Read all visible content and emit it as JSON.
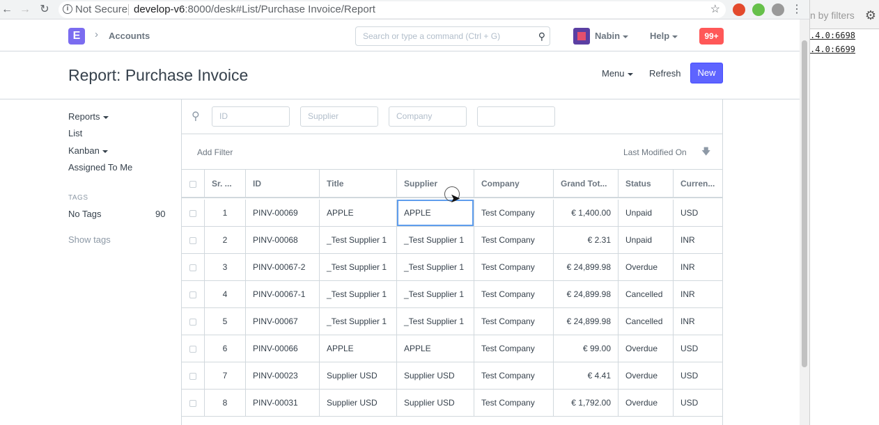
{
  "browser": {
    "not_secure": "Not Secure",
    "url_host": "develop-v6",
    "url_rest": ":8000/desk#List/Purchase Invoice/Report"
  },
  "devtools": {
    "filter_text": "n by filters",
    "line1": ".4.0:6698",
    "line2": ".4.0:6699"
  },
  "navbar": {
    "logo": "E",
    "breadcrumb": "Accounts",
    "search_placeholder": "Search or type a command (Ctrl + G)",
    "user": "Nabin",
    "help": "Help",
    "notifications": "99+"
  },
  "page": {
    "title": "Report: Purchase Invoice",
    "menu": "Menu",
    "refresh": "Refresh",
    "new": "New"
  },
  "sidebar": {
    "reports": "Reports",
    "list": "List",
    "kanban": "Kanban",
    "assigned": "Assigned To Me",
    "tags_heading": "TAGS",
    "no_tags": "No Tags",
    "no_tags_count": "90",
    "show_tags": "Show tags"
  },
  "filters": {
    "id_placeholder": "ID",
    "supplier_placeholder": "Supplier",
    "company_placeholder": "Company",
    "fourth_placeholder": "",
    "add_filter": "Add Filter",
    "sort_by": "Last Modified On"
  },
  "grid": {
    "columns": [
      "Sr. ...",
      "ID",
      "Title",
      "Supplier",
      "Company",
      "Grand Tot...",
      "Status",
      "Curren..."
    ],
    "rows": [
      {
        "sr": "1",
        "id": "PINV-00069",
        "title": "APPLE",
        "supplier": "APPLE",
        "company": "Test Company",
        "total": "€ 1,400.00",
        "status": "Unpaid",
        "currency": "USD"
      },
      {
        "sr": "2",
        "id": "PINV-00068",
        "title": "_Test Supplier 1",
        "supplier": "_Test Supplier 1",
        "company": "Test Company",
        "total": "€ 2.31",
        "status": "Unpaid",
        "currency": "INR"
      },
      {
        "sr": "3",
        "id": "PINV-00067-2",
        "title": "_Test Supplier 1",
        "supplier": "_Test Supplier 1",
        "company": "Test Company",
        "total": "€ 24,899.98",
        "status": "Overdue",
        "currency": "INR"
      },
      {
        "sr": "4",
        "id": "PINV-00067-1",
        "title": "_Test Supplier 1",
        "supplier": "_Test Supplier 1",
        "company": "Test Company",
        "total": "€ 24,899.98",
        "status": "Cancelled",
        "currency": "INR"
      },
      {
        "sr": "5",
        "id": "PINV-00067",
        "title": "_Test Supplier 1",
        "supplier": "_Test Supplier 1",
        "company": "Test Company",
        "total": "€ 24,899.98",
        "status": "Cancelled",
        "currency": "INR"
      },
      {
        "sr": "6",
        "id": "PINV-00066",
        "title": "APPLE",
        "supplier": "APPLE",
        "company": "Test Company",
        "total": "€ 99.00",
        "status": "Overdue",
        "currency": "USD"
      },
      {
        "sr": "7",
        "id": "PINV-00023",
        "title": "Supplier USD",
        "supplier": "Supplier USD",
        "company": "Test Company",
        "total": "€ 4.41",
        "status": "Overdue",
        "currency": "USD"
      },
      {
        "sr": "8",
        "id": "PINV-00031",
        "title": "Supplier USD",
        "supplier": "Supplier USD",
        "company": "Test Company",
        "total": "€ 1,792.00",
        "status": "Overdue",
        "currency": "USD"
      }
    ]
  },
  "colors": {
    "primary": "#5e64ff",
    "logo": "#7b6cf0",
    "notification": "#ff5858"
  }
}
